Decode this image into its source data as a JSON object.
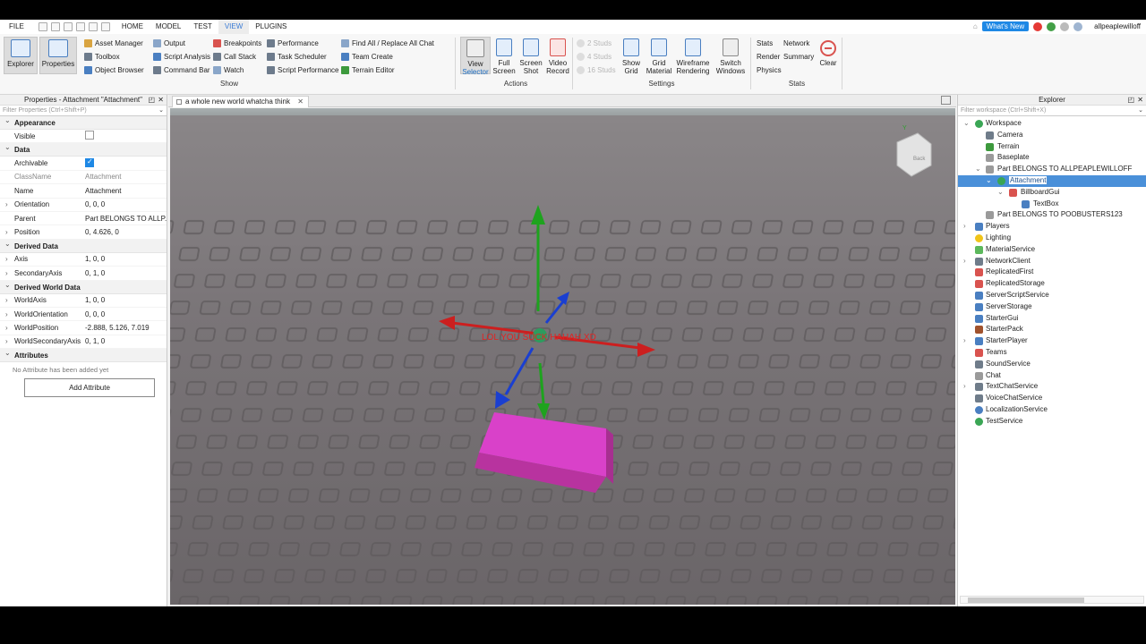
{
  "menubar": {
    "items": [
      "FILE",
      "HOME",
      "MODEL",
      "TEST",
      "VIEW",
      "PLUGINS"
    ],
    "active": "VIEW",
    "whats_new": "What's New",
    "username": "allpeaplewilloff"
  },
  "ribbon": {
    "explorer_label": "Explorer",
    "properties_label": "Properties",
    "col1": [
      "Asset Manager",
      "Toolbox",
      "Object Browser"
    ],
    "col2": [
      "Output",
      "Script Analysis",
      "Command Bar"
    ],
    "col3": [
      "Breakpoints",
      "Call Stack",
      "Watch"
    ],
    "col4": [
      "Performance",
      "Task Scheduler",
      "Script Performance"
    ],
    "col5": [
      "Find All / Replace All",
      "Team Create",
      "Terrain Editor"
    ],
    "chat": "Chat",
    "show_group": "Show",
    "actions": [
      {
        "line1": "View",
        "line2": "Selector"
      },
      {
        "line1": "Full",
        "line2": "Screen"
      },
      {
        "line1": "Screen",
        "line2": "Shot"
      },
      {
        "line1": "Video",
        "line2": "Record"
      }
    ],
    "actions_group": "Actions",
    "studs": [
      "2 Studs",
      "4 Studs",
      "16 Studs"
    ],
    "settings_btns": [
      {
        "line1": "Show",
        "line2": "Grid"
      },
      {
        "line1": "Grid",
        "line2": "Material"
      },
      {
        "line1": "Wireframe",
        "line2": "Rendering"
      },
      {
        "line1": "Switch",
        "line2": "Windows"
      }
    ],
    "settings_group": "Settings",
    "stats_col1": [
      "Stats",
      "Render",
      "Physics"
    ],
    "stats_col2": [
      "Network",
      "Summary"
    ],
    "clear": "Clear",
    "stats_group": "Stats"
  },
  "properties": {
    "title": "Properties - Attachment \"Attachment\"",
    "filter_placeholder": "Filter Properties (Ctrl+Shift+P)",
    "appearance": "Appearance",
    "visible": "Visible",
    "data": "Data",
    "archivable": "Archivable",
    "classname_label": "ClassName",
    "classname_value": "Attachment",
    "name_label": "Name",
    "name_value": "Attachment",
    "orientation_label": "Orientation",
    "orientation_value": "0, 0, 0",
    "parent_label": "Parent",
    "parent_value": "Part BELONGS TO ALLP...",
    "position_label": "Position",
    "position_value": "0, 4.626, 0",
    "derived": "Derived Data",
    "axis_label": "Axis",
    "axis_value": "1, 0, 0",
    "secaxis_label": "SecondaryAxis",
    "secaxis_value": "0, 1, 0",
    "derived_world": "Derived World Data",
    "worldaxis_label": "WorldAxis",
    "worldaxis_value": "1, 0, 0",
    "worldorient_label": "WorldOrientation",
    "worldorient_value": "0, 0, 0",
    "worldpos_label": "WorldPosition",
    "worldpos_value": "-2.888, 5.126, 7.019",
    "worldsec_label": "WorldSecondaryAxis",
    "worldsec_value": "0, 1, 0",
    "attributes": "Attributes",
    "no_attr": "No Attribute has been added yet",
    "add_attr": "Add Attribute"
  },
  "viewport": {
    "tab_label": "a whole new world whatcha think",
    "billboard_text": "LOL YOU SUCK HAHAH XD"
  },
  "explorer": {
    "title": "Explorer",
    "filter_placeholder": "Filter workspace (Ctrl+Shift+X)",
    "selected_label": "Attachment",
    "items": [
      {
        "label": "Workspace",
        "color": "#3aa655"
      },
      {
        "label": "Camera",
        "color": "#6f7c8a"
      },
      {
        "label": "Terrain",
        "color": "#3d9a3d"
      },
      {
        "label": "Baseplate",
        "color": "#9a9a9a"
      },
      {
        "label": "Part BELONGS TO ALLPEAPLEWILLOFF",
        "color": "#9a9a9a"
      },
      {
        "label": "Attachment",
        "color": "#3aa655"
      },
      {
        "label": "BillboardGui",
        "color": "#d9534f"
      },
      {
        "label": "TextBox",
        "color": "#4a7fc1"
      },
      {
        "label": "Part BELONGS TO POOBUSTERS123",
        "color": "#9a9a9a"
      },
      {
        "label": "Players",
        "color": "#4a7fc1"
      },
      {
        "label": "Lighting",
        "color": "#f0c419"
      },
      {
        "label": "MaterialService",
        "color": "#5cb85c"
      },
      {
        "label": "NetworkClient",
        "color": "#6f7c8a"
      },
      {
        "label": "ReplicatedFirst",
        "color": "#d9534f"
      },
      {
        "label": "ReplicatedStorage",
        "color": "#d9534f"
      },
      {
        "label": "ServerScriptService",
        "color": "#4a7fc1"
      },
      {
        "label": "ServerStorage",
        "color": "#4a7fc1"
      },
      {
        "label": "StarterGui",
        "color": "#4a7fc1"
      },
      {
        "label": "StarterPack",
        "color": "#a0522d"
      },
      {
        "label": "StarterPlayer",
        "color": "#4a7fc1"
      },
      {
        "label": "Teams",
        "color": "#d9534f"
      },
      {
        "label": "SoundService",
        "color": "#6f7c8a"
      },
      {
        "label": "Chat",
        "color": "#9a9a9a"
      },
      {
        "label": "TextChatService",
        "color": "#6f7c8a"
      },
      {
        "label": "VoiceChatService",
        "color": "#6f7c8a"
      },
      {
        "label": "LocalizationService",
        "color": "#4a7fc1"
      },
      {
        "label": "TestService",
        "color": "#3aa655"
      }
    ]
  }
}
